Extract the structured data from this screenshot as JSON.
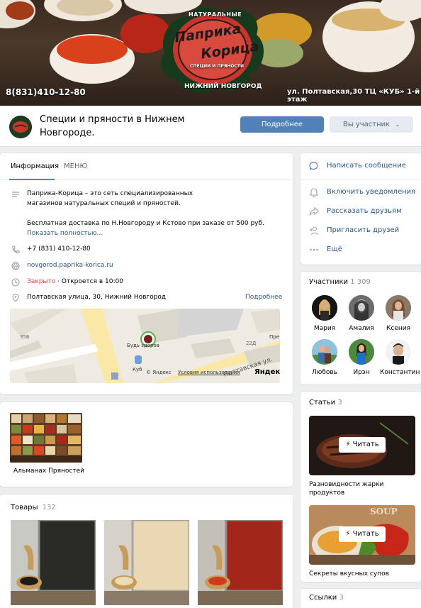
{
  "cover": {
    "phone": "8(831)410-12-80",
    "address": "ул. Полтавская,30 ТЦ «КУБ» 1-й этаж",
    "logo_top": "НАТУРАЛЬНЫЕ",
    "logo_main_1": "Паприка",
    "logo_main_2": "Корица",
    "logo_bottom": "СПЕЦИИ И ПРЯНОСТИ",
    "city": "НИЖНИЙ НОВГОРОД"
  },
  "header": {
    "title": "Специи и пряности в Нижнем Новгороде.",
    "more_button": "Подробнее",
    "member_button": "Вы участник"
  },
  "info": {
    "tabs": [
      "Информация",
      "МЕНЮ"
    ],
    "description_1": "Паприка-Корица – это сеть специализированных магазинов натуральных специй и пряностей.",
    "description_2": "Бесплатная доставка по Н.Новгороду и Кстово при заказе от 500 руб.",
    "show_full": "Показать полностью…",
    "phone": "+7 (831) 410-12-80",
    "website": "novgorod.paprika-korica.ru",
    "status_closed": "Закрыто",
    "status_opens": "· Откроется в 10:00",
    "address": "Полтавская улица, 30, Нижний Новгород",
    "address_more": "Подробнее",
    "map": {
      "label_1": "Будь здоров",
      "label_2": "Куб",
      "label_3": "Пре",
      "label_4": "22Д",
      "label_5": "35Б",
      "street": "Полтавская ул.",
      "copyright": "© Яндекс",
      "terms": "Условия использования",
      "brand": "Яндекс"
    }
  },
  "album": {
    "title": "Альманах Пряностей"
  },
  "goods": {
    "title": "Товары",
    "count": "132"
  },
  "actions": {
    "items": [
      {
        "label": "Написать сообщение",
        "icon": "message-icon"
      },
      {
        "label": "Включить уведомления",
        "icon": "bell-icon"
      },
      {
        "label": "Рассказать друзьям",
        "icon": "share-icon"
      },
      {
        "label": "Пригласить друзей",
        "icon": "add-user-icon"
      },
      {
        "label": "Ещё",
        "icon": "more-icon"
      }
    ]
  },
  "members": {
    "title": "Участники",
    "count": "1 309",
    "people": [
      "Мария",
      "Амалия",
      "Ксения",
      "Любовь",
      "Ирэн",
      "Константин"
    ]
  },
  "articles": {
    "title": "Статьи",
    "count": "3",
    "read_label": "Читать",
    "items": [
      {
        "title": "Разновидности жарки продуктов"
      },
      {
        "title": "Секреты вкусных супов",
        "overlay": "SOUP"
      }
    ]
  },
  "links": {
    "title": "Ссылки",
    "count": "3"
  },
  "colors": {
    "accent": "#5181b8",
    "link": "#2a5885",
    "closed": "#e64646",
    "background": "#edeef0"
  }
}
